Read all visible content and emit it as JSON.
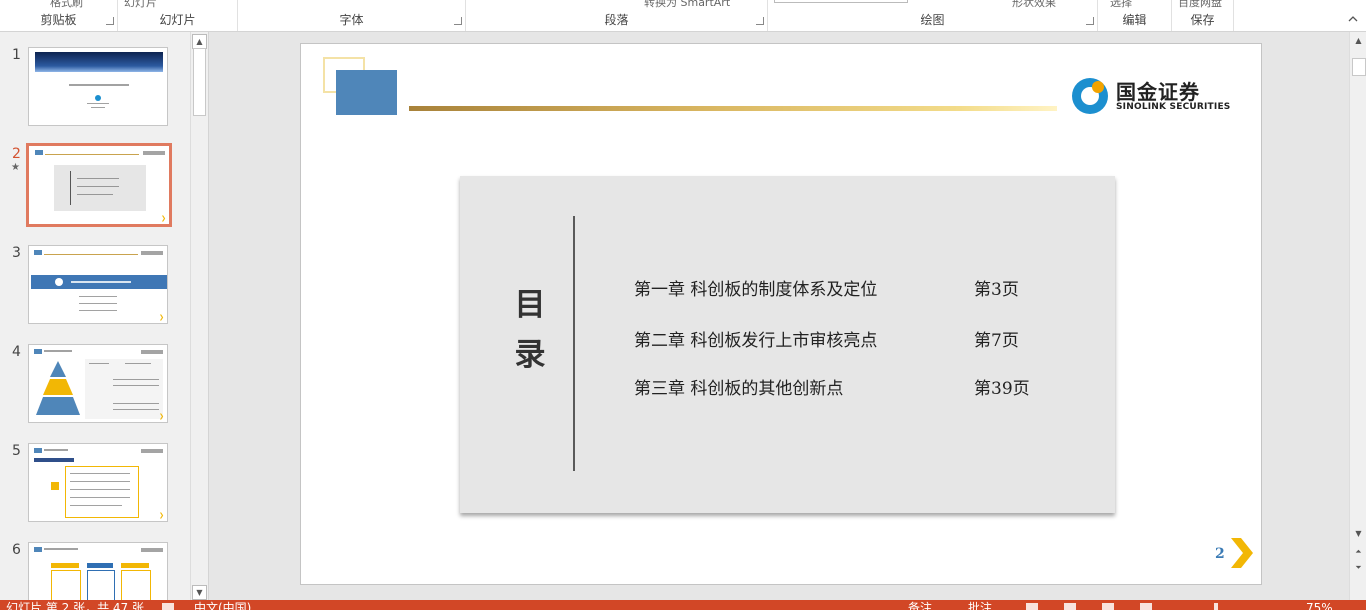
{
  "ribbon": {
    "groups": [
      {
        "label": "剪贴板",
        "top_fragment": "格式刷"
      },
      {
        "label": "幻灯片",
        "top_fragment": "幻灯片"
      },
      {
        "label": "字体",
        "top_fragment": ""
      },
      {
        "label": "段落",
        "top_fragment": "转换为 SmartArt"
      },
      {
        "label": "绘图",
        "top_fragment": "形状效果"
      },
      {
        "label": "编辑",
        "top_fragment": "选择"
      },
      {
        "label": "保存",
        "top_fragment": "百度网盘"
      }
    ]
  },
  "thumbnails": [
    {
      "number": "1",
      "active": false
    },
    {
      "number": "2",
      "active": true,
      "star": "★"
    },
    {
      "number": "3",
      "active": false
    },
    {
      "number": "4",
      "active": false
    },
    {
      "number": "5",
      "active": false
    },
    {
      "number": "6",
      "active": false
    }
  ],
  "slide": {
    "logo": {
      "cn": "国金证券",
      "en": "SINOLINK SECURITIES"
    },
    "toc_title": "目录",
    "toc_items": [
      {
        "chapter": "第一章  科创板的制度体系及定位",
        "page": "第3页"
      },
      {
        "chapter": "第二章  科创板发行上市审核亮点",
        "page": "第7页"
      },
      {
        "chapter": "第三章  科创板的其他创新点",
        "page": "第39页"
      }
    ],
    "page_number": "2"
  },
  "status": {
    "slide_info": "幻灯片 第 2 张，共 47 张",
    "language": "中文(中国)",
    "notes": "备注",
    "comments": "批注",
    "zoom": "75%"
  },
  "colors": {
    "accent_blue": "#4f86b9",
    "gold": "#d8b560",
    "chevron_yellow": "#f2b705",
    "status_bar": "#d24726",
    "selection_border": "#e07a5f"
  }
}
